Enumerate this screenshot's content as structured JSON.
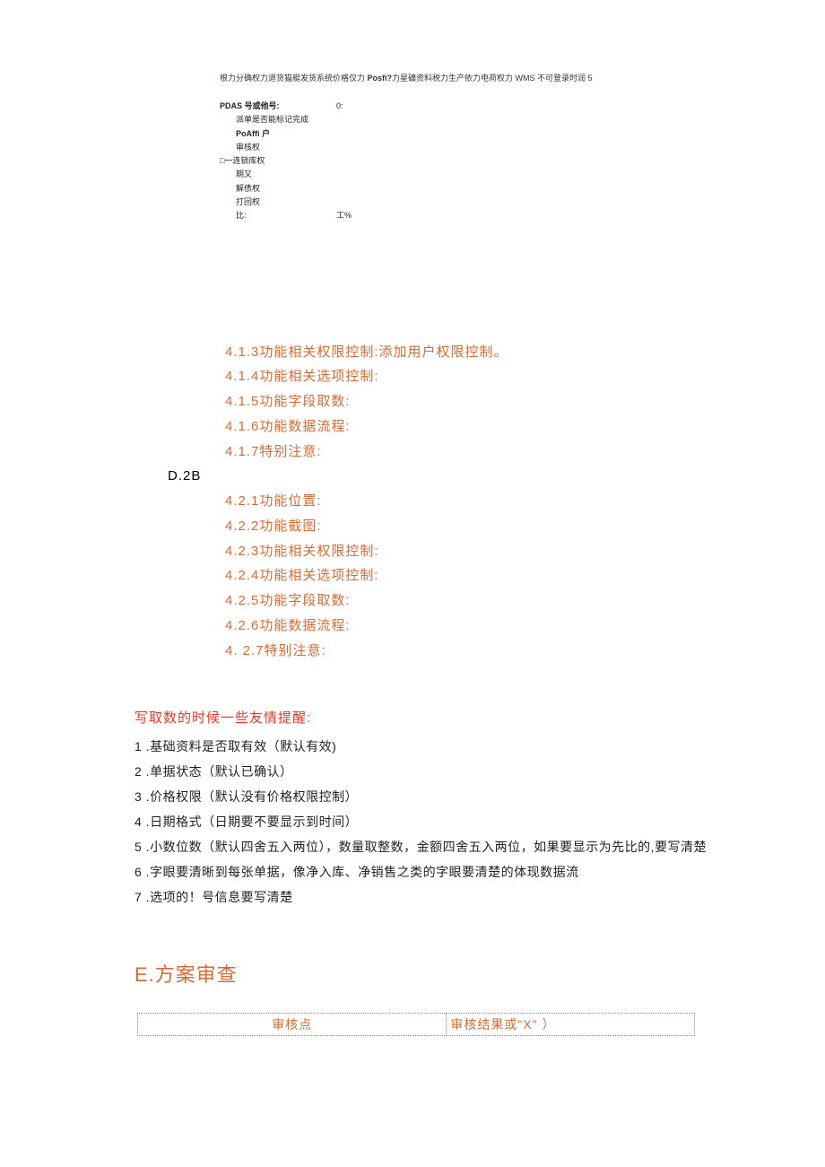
{
  "topHeader": {
    "prefix": "根力分确权力退货猫艇发货系统价格仅力 ",
    "mid": "Posfi?",
    "suffix": "力星礦资料税力生产依力电荷权力 WMS 不可登录时润 5"
  },
  "params": {
    "r0": {
      "label": "PDAS 号或他号:",
      "val": "0:"
    },
    "r1": {
      "label": "派单是否能标记完成"
    },
    "r2": {
      "label": "PoAffi 户"
    },
    "r3": {
      "label": "审核权"
    },
    "r4": {
      "label": "□一连锁库权"
    },
    "r5": {
      "label": "期又"
    },
    "r6": {
      "label": "解债权"
    },
    "r7": {
      "label": "打回权"
    },
    "r8": {
      "label": "比:",
      "val": "工%"
    }
  },
  "sections41": {
    "i3": "4.1.3功能相关权限控制:添加用户权限控制。",
    "i4": "4.1.4功能相关选项控制:",
    "i5": "4.1.5功能字段取数:",
    "i6": "4.1.6功能数据流程:",
    "i7": "4.1.7特别注意:"
  },
  "sectionD": "D.2B",
  "sections42": {
    "i1": "4.2.1功能位置:",
    "i2": "4.2.2功能截图:",
    "i3": "4.2.3功能相关权限控制:",
    "i4": "4.2.4功能相关选项控制:",
    "i5": "4.2.5功能字段取数:",
    "i6": "4.2.6功能数据流程:",
    "i7": "4. 2.7特别注意:"
  },
  "reminder": {
    "title": "写取数的时候一些友情提醒:",
    "l1": "1 .基础资料是否取有效（默认有效)",
    "l2": "2 .单据状态（默认已确认）",
    "l3": "3 .价格权限（默认没有价格权限控制）",
    "l4": "4 .日期格式（日期要不要显示到时间）",
    "l5": "5 .小数位数（默认四舍五入两位），数量取整数，金额四舍五入两位，如果要显示为先比的,要写清楚",
    "l6": "6 .字眼要清晰到每张单据，像净入库、净销售之类的字眼要清楚的体现数据流",
    "l7": "7 .选项的！号信息要写清楚"
  },
  "review": {
    "heading": "E.方案审查",
    "col1": "审核点",
    "col2": "审核结果或\"X\" ）"
  }
}
